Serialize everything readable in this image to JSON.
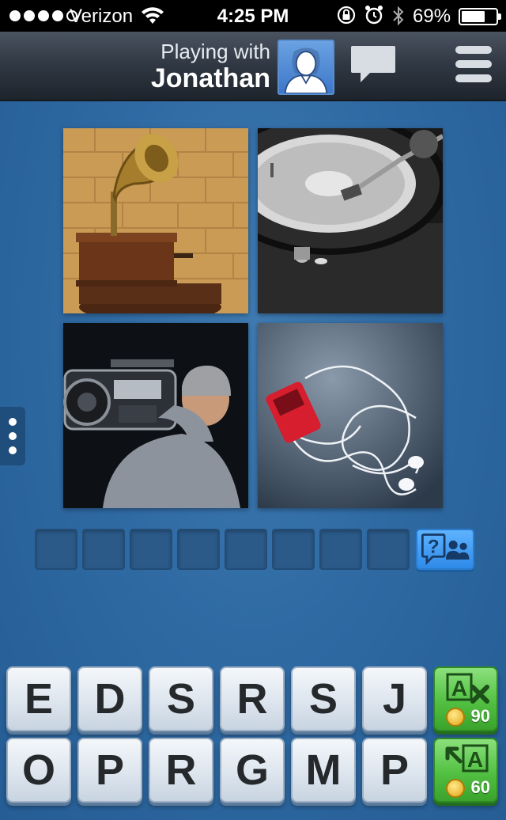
{
  "status_bar": {
    "carrier": "Verizon",
    "time": "4:25 PM",
    "battery": "69%",
    "battery_level": 0.69,
    "signal_bars": 4
  },
  "header": {
    "subtitle": "Playing with",
    "player_name": "Jonathan",
    "avatar_icon": "person-silhouette-icon",
    "chat_icon": "chat-bubble-icon",
    "menu_icon": "hamburger-menu-icon"
  },
  "photos": [
    {
      "name": "gramophone-photo"
    },
    {
      "name": "turntable-photo"
    },
    {
      "name": "boombox-photo"
    },
    {
      "name": "mp3-player-photo"
    }
  ],
  "answer": {
    "slot_count": 8,
    "ask_friends_icon": "ask-friends-icon"
  },
  "keyboard": {
    "row1": [
      "E",
      "D",
      "S",
      "R",
      "S",
      "J"
    ],
    "row2": [
      "O",
      "P",
      "R",
      "G",
      "M",
      "P"
    ],
    "remove_letters": {
      "icon": "remove-letters-icon",
      "cost": "90"
    },
    "reveal_letter": {
      "icon": "reveal-letter-icon",
      "cost": "60"
    }
  },
  "colors": {
    "background": "#2f6aa3",
    "power_green": "#52c042",
    "ask_blue": "#2f8ae8"
  }
}
